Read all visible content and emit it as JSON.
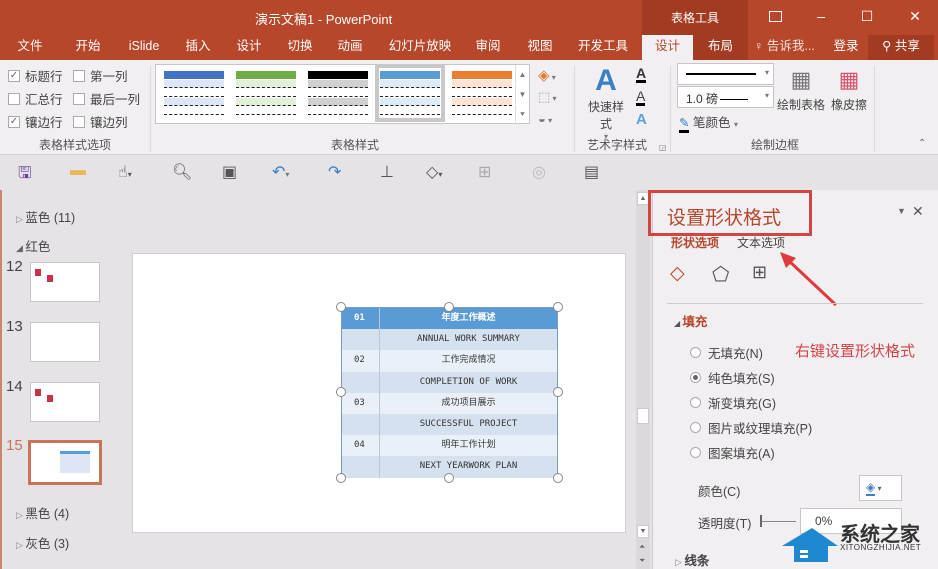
{
  "window": {
    "title": "演示文稿1 - PowerPoint",
    "context_tab_group": "表格工具",
    "controls": {
      "ribbon_display": "ribbon-display-icon",
      "minimize": "–",
      "maximize": "☐",
      "close": "✕"
    }
  },
  "menu": {
    "items": [
      "文件",
      "开始",
      "iSlide",
      "插入",
      "设计",
      "切换",
      "动画",
      "幻灯片放映",
      "审阅",
      "视图",
      "开发工具",
      "设计",
      "布局"
    ],
    "active_index": 11,
    "tell_me": "告诉我...",
    "login": "登录",
    "share": "共享"
  },
  "ribbon": {
    "table_style_options": {
      "label": "表格样式选项",
      "checkboxes": [
        {
          "label": "标题行",
          "checked": true
        },
        {
          "label": "第一列",
          "checked": false
        },
        {
          "label": "汇总行",
          "checked": false
        },
        {
          "label": "最后一列",
          "checked": false
        },
        {
          "label": "镶边行",
          "checked": true
        },
        {
          "label": "镶边列",
          "checked": false
        }
      ]
    },
    "table_styles": {
      "label": "表格样式",
      "swatches": [
        {
          "name": "blue",
          "header": "#4472c4",
          "band": "#dce6f4",
          "selected": false
        },
        {
          "name": "green",
          "header": "#70ad47",
          "band": "#e2efd9",
          "selected": false
        },
        {
          "name": "black",
          "header": "#000000",
          "band": "#d0d0d0",
          "selected": false
        },
        {
          "name": "light-blue",
          "header": "#5b9bd5",
          "band": "#ddebf7",
          "selected": true
        },
        {
          "name": "orange",
          "header": "#ed7d31",
          "band": "#fbe4d5",
          "selected": false
        }
      ]
    },
    "wordart": {
      "label": "艺术字样式",
      "quick_styles": "快速样式"
    },
    "draw_borders": {
      "label": "绘制边框",
      "pen_weight": "1.0 磅",
      "pen_color": "笔颜色",
      "draw_table": "绘制表格",
      "eraser": "橡皮擦"
    }
  },
  "slides_panel": {
    "sections": [
      {
        "label": "蓝色 (11)",
        "expanded": false
      },
      {
        "label": "红色",
        "expanded": true
      },
      {
        "label": "黑色 (4)",
        "expanded": false
      },
      {
        "label": "灰色 (3)",
        "expanded": false
      }
    ],
    "slides": [
      {
        "number": "12",
        "selected": false
      },
      {
        "number": "13",
        "selected": false
      },
      {
        "number": "14",
        "selected": false
      },
      {
        "number": "15",
        "selected": true
      }
    ]
  },
  "slide_table": {
    "header_color": "#5b9bd5",
    "rows": [
      {
        "num": "01",
        "text": "年度工作概述",
        "header": true
      },
      {
        "num": "",
        "text": "ANNUAL WORK SUMMARY"
      },
      {
        "num": "02",
        "text": "工作完成情况"
      },
      {
        "num": "",
        "text": "COMPLETION OF WORK"
      },
      {
        "num": "03",
        "text": "成功项目展示"
      },
      {
        "num": "",
        "text": "SUCCESSFUL PROJECT"
      },
      {
        "num": "04",
        "text": "明年工作计划"
      },
      {
        "num": "",
        "text": "NEXT YEARWORK PLAN"
      }
    ]
  },
  "format_pane": {
    "title": "设置形状格式",
    "tabs": [
      "形状选项",
      "文本选项"
    ],
    "active_tab": 0,
    "annotation": "右键设置形状格式",
    "fill_section": "填充",
    "fill_options": [
      {
        "label": "无填充(N)",
        "checked": false
      },
      {
        "label": "纯色填充(S)",
        "checked": true
      },
      {
        "label": "渐变填充(G)",
        "checked": false
      },
      {
        "label": "图片或纹理填充(P)",
        "checked": false
      },
      {
        "label": "图案填充(A)",
        "checked": false
      }
    ],
    "color_label": "颜色(C)",
    "transparency_label": "透明度(T)",
    "transparency_value": "0%",
    "line_section": "线条"
  },
  "watermark": {
    "title": "系统之家",
    "url": "XITONGZHIJIA.NET"
  }
}
